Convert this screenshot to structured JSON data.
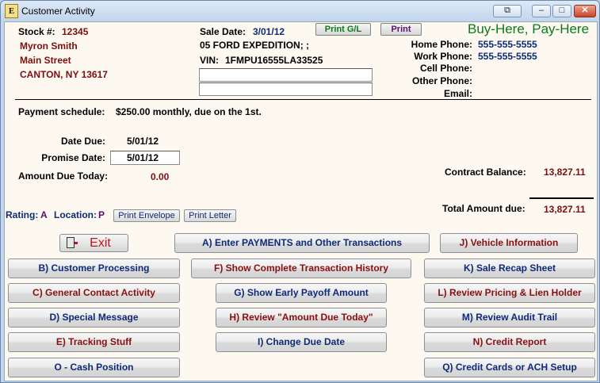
{
  "window": {
    "title": "Customer Activity",
    "app_icon": "E",
    "controls": {
      "restore_alt": "⧉",
      "minimize": "–",
      "maximize": "□",
      "close": "✕"
    }
  },
  "header": {
    "stock_label": "Stock #:",
    "stock_value": "12345",
    "customer_name": "Myron Smith",
    "street": "Main Street",
    "city_state_zip": "CANTON, NY 13617",
    "sale_date_label": "Sale Date:",
    "sale_date_value": "3/01/12",
    "vehicle": "05 FORD EXPEDITION; ;",
    "vin_label": "VIN:",
    "vin_value": "1FMPU16555LA33525",
    "print_gl_label": "Print G/L",
    "print_label": "Print",
    "brand": "Buy-Here, Pay-Here"
  },
  "phones": [
    {
      "label": "Home Phone:",
      "value": "555-555-5555"
    },
    {
      "label": "Work Phone:",
      "value": "555-555-5555"
    },
    {
      "label": "Cell Phone:",
      "value": ""
    },
    {
      "label": "Other Phone:",
      "value": ""
    },
    {
      "label": "Email:",
      "value": ""
    }
  ],
  "payment": {
    "schedule_label": "Payment schedule:",
    "schedule_value": "$250.00 monthly, due on the 1st.",
    "date_due_label": "Date Due:",
    "date_due_value": "5/01/12",
    "promise_label": "Promise Date:",
    "promise_value": "5/01/12",
    "amount_due_label": "Amount Due Today:",
    "amount_due_value": "0.00",
    "contract_balance_label": "Contract Balance:",
    "contract_balance_value": "13,827.11",
    "total_due_label": "Total Amount due:",
    "total_due_value": "13,827.11"
  },
  "rating": {
    "rating_label": "Rating:",
    "rating_value": "A",
    "location_label": "Location:",
    "location_value": "P",
    "print_envelope": "Print Envelope",
    "print_letter": "Print Letter"
  },
  "buttons": {
    "exit": "Exit",
    "enter_payments": "A) Enter PAYMENTS and Other Transactions",
    "vehicle_info": "J) Vehicle Information",
    "customer_processing": "B) Customer Processing",
    "transaction_history": "F) Show Complete Transaction History",
    "sale_recap": "K) Sale Recap Sheet",
    "general_contact": "C) General Contact Activity",
    "early_payoff": "G) Show Early Payoff Amount",
    "pricing_lien": "L) Review Pricing & Lien Holder",
    "special_message": "D) Special Message",
    "review_amount_due": "H) Review \"Amount Due Today\"",
    "audit_trail": "M) Review Audit Trail",
    "tracking_stuff": "E) Tracking Stuff",
    "change_due_date": "I) Change Due Date",
    "credit_report": "N) Credit Report",
    "cash_position": "O - Cash Position",
    "credit_cards_ach": "Q) Credit Cards or ACH Setup"
  },
  "colors": {
    "maroon": "#7a0f0f",
    "navy": "#0e2a78",
    "brand_green": "#0a7a1a",
    "background": "#fdf9f1"
  }
}
